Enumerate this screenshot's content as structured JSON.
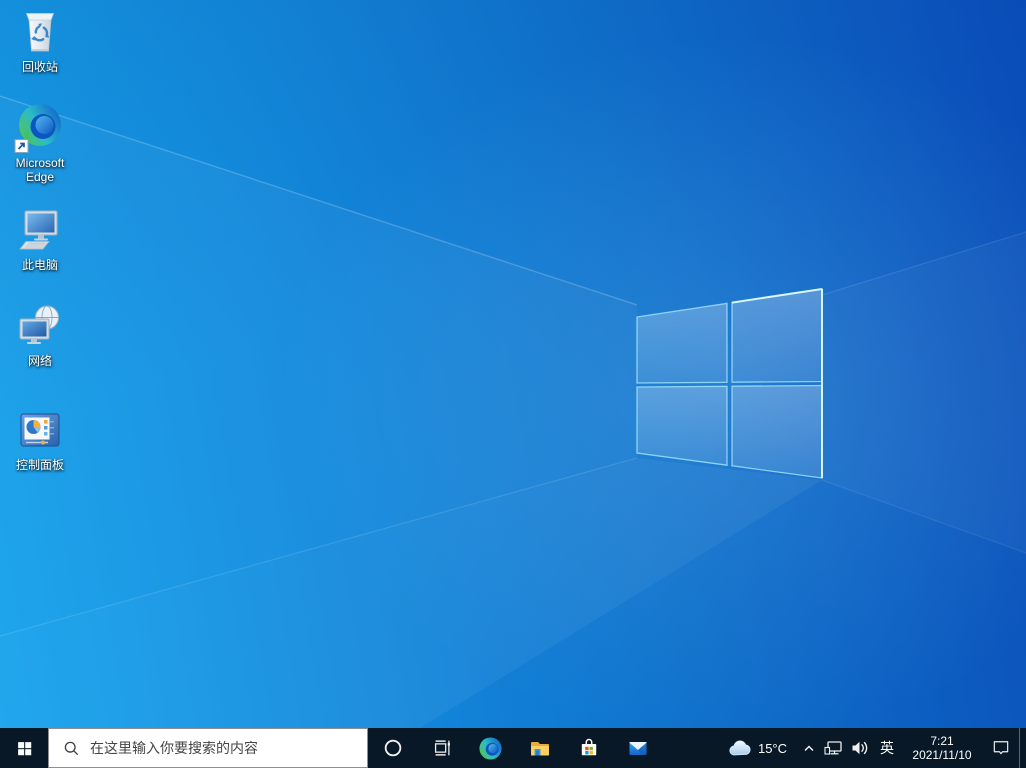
{
  "colors": {
    "wallpaper_bright": "#16a3ec",
    "wallpaper_dark": "#0a4cb8",
    "logo_edge_highlight": "#b9f3ff",
    "taskbar_bg": "#081826",
    "search_box_bg": "#ffffff",
    "search_text": "#454545",
    "tray_text": "#ffffff"
  },
  "desktop": {
    "icons": [
      {
        "id": "recycle-bin",
        "icon": "recycle-bin-icon",
        "label": "回收站"
      },
      {
        "id": "microsoft-edge",
        "icon": "edge-icon",
        "label": "Microsoft Edge"
      },
      {
        "id": "this-pc",
        "icon": "computer-icon",
        "label": "此电脑"
      },
      {
        "id": "network",
        "icon": "network-globe-icon",
        "label": "网络"
      },
      {
        "id": "control-panel",
        "icon": "control-panel-icon",
        "label": "控制面板"
      }
    ],
    "wallpaper_logo": "windows-logo"
  },
  "taskbar": {
    "start": {
      "icon": "windows-start-icon"
    },
    "search": {
      "icon": "search-icon",
      "placeholder": "在这里输入你要搜索的内容"
    },
    "apps": [
      {
        "id": "cortana",
        "icon": "cortana-circle-icon"
      },
      {
        "id": "task-view",
        "icon": "task-view-icon"
      },
      {
        "id": "edge",
        "icon": "edge-icon"
      },
      {
        "id": "file-explorer",
        "icon": "folder-icon"
      },
      {
        "id": "microsoft-store",
        "icon": "store-bag-icon"
      },
      {
        "id": "mail",
        "icon": "mail-envelope-icon"
      }
    ],
    "tray": {
      "weather": {
        "icon": "cloud-icon",
        "temperature": "15°C"
      },
      "hidden_icons_icon": "chevron-up-icon",
      "network_icon": "ethernet-icon",
      "volume_icon": "speaker-icon",
      "ime_indicator": "英",
      "clock": {
        "time": "7:21",
        "date": "2021/11/10"
      },
      "action_center_icon": "action-center-icon",
      "show_desktop": "show-desktop-strip"
    }
  }
}
